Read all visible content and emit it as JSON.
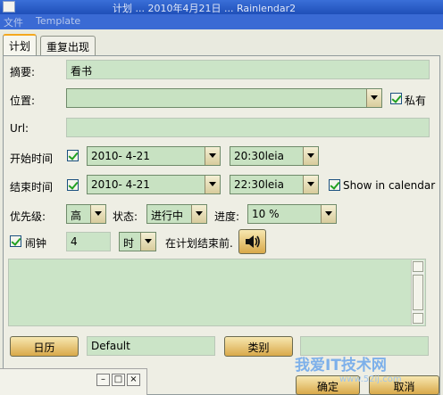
{
  "window": {
    "title": "计划 ... 2010年4月21日 ... Rainlendar2"
  },
  "menu": {
    "file": "文件",
    "template": "Template"
  },
  "tabs": [
    {
      "label": "计划"
    },
    {
      "label": "重复出现"
    }
  ],
  "form": {
    "summary_label": "摘要:",
    "summary_value": "看书",
    "location_label": "位置:",
    "location_value": "",
    "private_label": "私有",
    "url_label": "Url:",
    "url_value": "",
    "start_label": "开始时间",
    "start_date": "2010-  4-21",
    "start_time": "20:30leia",
    "end_label": "结束时间",
    "end_date": "2010-  4-21",
    "end_time": "22:30leia",
    "show_in_calendar": "Show in calendar",
    "priority_label": "优先级:",
    "priority_value": "高",
    "status_label": "状态:",
    "status_value": "进行中",
    "progress_label": "进度:",
    "progress_value": "10 %",
    "alarm_label": "闹钟",
    "alarm_amount": "4",
    "alarm_unit": "时",
    "alarm_when": "在计划结束前.",
    "notes": "",
    "calendar_button": "日历",
    "calendar_value": "Default",
    "category_button": "类别",
    "category_value": ""
  },
  "footer": {
    "ok": "确定",
    "cancel": "取消"
  },
  "watermark": {
    "brand": "我爱IT技术网",
    "url": "www.52ij.com"
  }
}
